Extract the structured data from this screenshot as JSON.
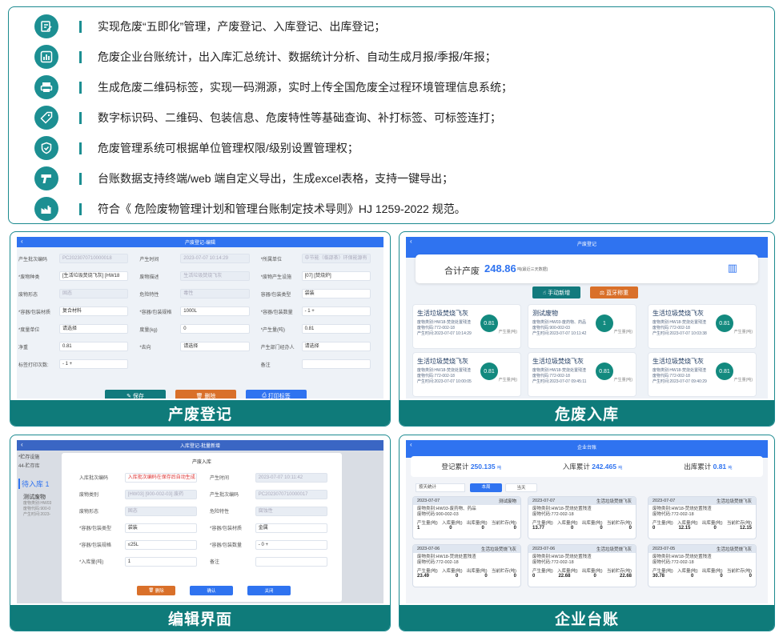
{
  "features": [
    {
      "icon": "edit-icon",
      "text": "实现危废“五即化”管理，产废登记、入库登记、出库登记；"
    },
    {
      "icon": "bar-chart-icon",
      "text": "危废企业台账统计，出入库汇总统计、数据统计分析、自动生成月报/季报/年报；"
    },
    {
      "icon": "printer-icon",
      "text": "生成危废二维码标签，实现一码溯源，实时上传全国危废全过程环境管理信息系统；"
    },
    {
      "icon": "tag-icon",
      "text": "数字标识码、二维码、包装信息、危废特性等基础查询、补打标签、可标签连打；"
    },
    {
      "icon": "shield-icon",
      "text": "危废管理系统可根据单位管理权限/级别设置管理权；"
    },
    {
      "icon": "scanner-icon",
      "text": "台账数据支持终端/web 端自定义导出，生成excel表格，支持一键导出；"
    },
    {
      "icon": "factory-icon",
      "text": "符合《 危险废物管理计划和管理台账制定技术导则》HJ 1259-2022 规范。"
    }
  ],
  "panels": {
    "p1": {
      "caption": "产废登记",
      "title": "产废登记-编辑",
      "rows": [
        [
          {
            "l": "产生批次编码",
            "v": "PC2023070710000018",
            "d": true
          },
          {
            "l": "产生时间",
            "v": "2023-07-07 10:14:29",
            "d": true
          },
          {
            "l": "*所属单位",
            "v": "中节能（临邵茶）环保能源有",
            "d": true
          }
        ],
        [
          {
            "l": "*废物种类",
            "v": "[生活垃圾焚烧飞灰] [HW18",
            "d": false
          },
          {
            "l": "废物描述",
            "v": "生活垃圾焚烧飞灰",
            "d": true
          },
          {
            "l": "*废物产生设施",
            "v": "[07] [焚烧炉]",
            "d": false
          }
        ],
        [
          {
            "l": "废物形态",
            "v": "固态",
            "d": true
          },
          {
            "l": "危险特性",
            "v": "毒性",
            "d": true
          },
          {
            "l": "容器/包装类型",
            "v": "袋装",
            "d": false
          }
        ],
        [
          {
            "l": "*容器/包装材质",
            "v": "复合材料",
            "d": false
          },
          {
            "l": "*容器/包装规格",
            "v": "1000L",
            "d": false
          },
          {
            "l": "*容器/包装数量",
            "v": "-  1  +",
            "d": false
          }
        ],
        [
          {
            "l": "*度量单位",
            "v": "请选择",
            "d": false
          },
          {
            "l": "度量(kg)",
            "v": "0",
            "d": false
          },
          {
            "l": "*产生量(吨)",
            "v": "0.81",
            "d": false
          }
        ],
        [
          {
            "l": "净重",
            "v": "0.81",
            "d": false
          },
          {
            "l": "*去向",
            "v": "请选择",
            "d": false
          },
          {
            "l": "产生部门经办人",
            "v": "请选择",
            "d": false
          }
        ],
        [
          {
            "l": "标签打印次数:",
            "v": "-  1  +",
            "d": false
          },
          {
            "l": "",
            "v": "",
            "d": false
          },
          {
            "l": "备注",
            "v": "",
            "d": false
          }
        ]
      ],
      "buttons": {
        "save": "保存",
        "delete": "删除",
        "print": "打印标签"
      }
    },
    "p2": {
      "caption": "危废入库",
      "title": "产废登记",
      "total_label": "合计产废",
      "total_value": "248.86",
      "total_unit": "吨(最近三天数据)",
      "btn_manual": "手动新增",
      "btn_bt": "蓝牙称重",
      "cards": [
        {
          "t": "生活垃圾焚烧飞灰",
          "l1": "废物类别:HW18-焚烧处置残渣",
          "l2": "废物代码:772-002-18",
          "l3": "产生时间:2023-07-07 10:14:29",
          "v": "0.81"
        },
        {
          "t": "测试废物",
          "l1": "废物类别:HW03-废药物、药品",
          "l2": "废物代码:900-002-03",
          "l3": "产生时间:2023-07-07 10:11:42",
          "v": "1"
        },
        {
          "t": "生活垃圾焚烧飞灰",
          "l1": "废物类别:HW18-焚烧处置残渣",
          "l2": "废物代码:772-002-18",
          "l3": "产生时间:2023-07-07 10:03:38",
          "v": "0.81"
        },
        {
          "t": "生活垃圾焚烧飞灰",
          "l1": "废物类别:HW18-焚烧处置残渣",
          "l2": "废物代码:772-002-18",
          "l3": "产生时间:2023-07-07 10:00:05",
          "v": "0.81"
        },
        {
          "t": "生活垃圾焚烧飞灰",
          "l1": "废物类别:HW18-焚烧处置残渣",
          "l2": "废物代码:772-002-18",
          "l3": "产生时间:2023-07-07 09:45:11",
          "v": "0.81"
        },
        {
          "t": "生活垃圾焚烧飞灰",
          "l1": "废物类别:HW18-焚烧处置残渣",
          "l2": "废物代码:772-002-18",
          "l3": "产生时间:2023-07-07 09:40:29",
          "v": "0.81"
        }
      ],
      "unit": "产生量(吨)"
    },
    "p3": {
      "caption": "编辑界面",
      "title": "入库登记-批量新增",
      "side_label": "*贮存设施",
      "side_value": "44-贮存库",
      "side_list_title": "待入库 1",
      "side_item": "测试废物",
      "side_l1": "废物类别:HW03",
      "side_l2": "废物代码:900-0",
      "side_l3": "产生时间:2023-",
      "dialog_title": "产废入库",
      "rows": [
        [
          {
            "l": "入库批次编码",
            "v": "入库批次编码在保存后自动生成",
            "d": false,
            "red": true
          },
          {
            "l": "产生时间",
            "v": "2023-07-07 10:11:42",
            "d": true
          }
        ],
        [
          {
            "l": "废物类别",
            "v": "[HW03] [900-002-03] 废药",
            "d": true
          },
          {
            "l": "产生批次编码",
            "v": "PC2023070710000017",
            "d": true
          }
        ],
        [
          {
            "l": "废物形态",
            "v": "固态",
            "d": true
          },
          {
            "l": "危险特性",
            "v": "腐蚀性",
            "d": true
          }
        ],
        [
          {
            "l": "*容器/包装类型",
            "v": "袋装",
            "d": false
          },
          {
            "l": "*容器/包装材质",
            "v": "金属",
            "d": false
          }
        ],
        [
          {
            "l": "*容器/包装规格",
            "v": "≤25L",
            "d": false
          },
          {
            "l": "*容器/包装数量",
            "v": "-  0  +",
            "d": false
          }
        ],
        [
          {
            "l": "*入库量(吨)",
            "v": "1",
            "d": false
          },
          {
            "l": "备注",
            "v": "",
            "d": false
          }
        ]
      ],
      "buttons": {
        "delete": "删除",
        "confirm": "确认",
        "close": "关闭"
      }
    },
    "p4": {
      "caption": "企业台账",
      "title": "企业台账",
      "stats": [
        {
          "l": "登记累计",
          "v": "250.135",
          "u": "吨"
        },
        {
          "l": "入库累计",
          "v": "242.465",
          "u": "吨"
        },
        {
          "l": "出库累计",
          "v": "0.81",
          "u": "吨"
        }
      ],
      "filter": "按天统计",
      "tab_week": "本周",
      "tab_today": "当天",
      "cols": [
        "产生量(吨)",
        "入库量(吨)",
        "出库量(吨)",
        "当前贮存(吨)"
      ],
      "ledgers": [
        {
          "date": "2023-07-07",
          "name": "测试废物",
          "l1": "废物类别:HW03-废药物、药品",
          "l2": "废物代码:900-002-03",
          "vals": [
            "1",
            "0",
            "0",
            "0"
          ]
        },
        {
          "date": "2023-07-07",
          "name": "生活垃圾焚烧飞灰",
          "l1": "废物类别:HW18-焚烧处置残渣",
          "l2": "废物代码:772-002-18",
          "vals": [
            "13.77",
            "0",
            "0",
            "0"
          ]
        },
        {
          "date": "2023-07-07",
          "name": "生活垃圾焚烧飞灰",
          "l1": "废物类别:HW18-焚烧处置残渣",
          "l2": "废物代码:772-002-18",
          "vals": [
            "0",
            "12.15",
            "0",
            "12.15"
          ]
        },
        {
          "date": "2023-07-06",
          "name": "生活垃圾焚烧飞灰",
          "l1": "废物类别:HW18-焚烧处置残渣",
          "l2": "废物代码:772-002-18",
          "vals": [
            "23.49",
            "0",
            "0",
            "0"
          ]
        },
        {
          "date": "2023-07-06",
          "name": "生活垃圾焚烧飞灰",
          "l1": "废物类别:HW18-焚烧处置残渣",
          "l2": "废物代码:772-002-18",
          "vals": [
            "0",
            "22.68",
            "0",
            "22.68"
          ]
        },
        {
          "date": "2023-07-05",
          "name": "生活垃圾焚烧飞灰",
          "l1": "废物类别:HW18-焚烧处置残渣",
          "l2": "废物代码:772-002-18",
          "vals": [
            "30.78",
            "0",
            "0",
            "0"
          ]
        }
      ]
    }
  }
}
